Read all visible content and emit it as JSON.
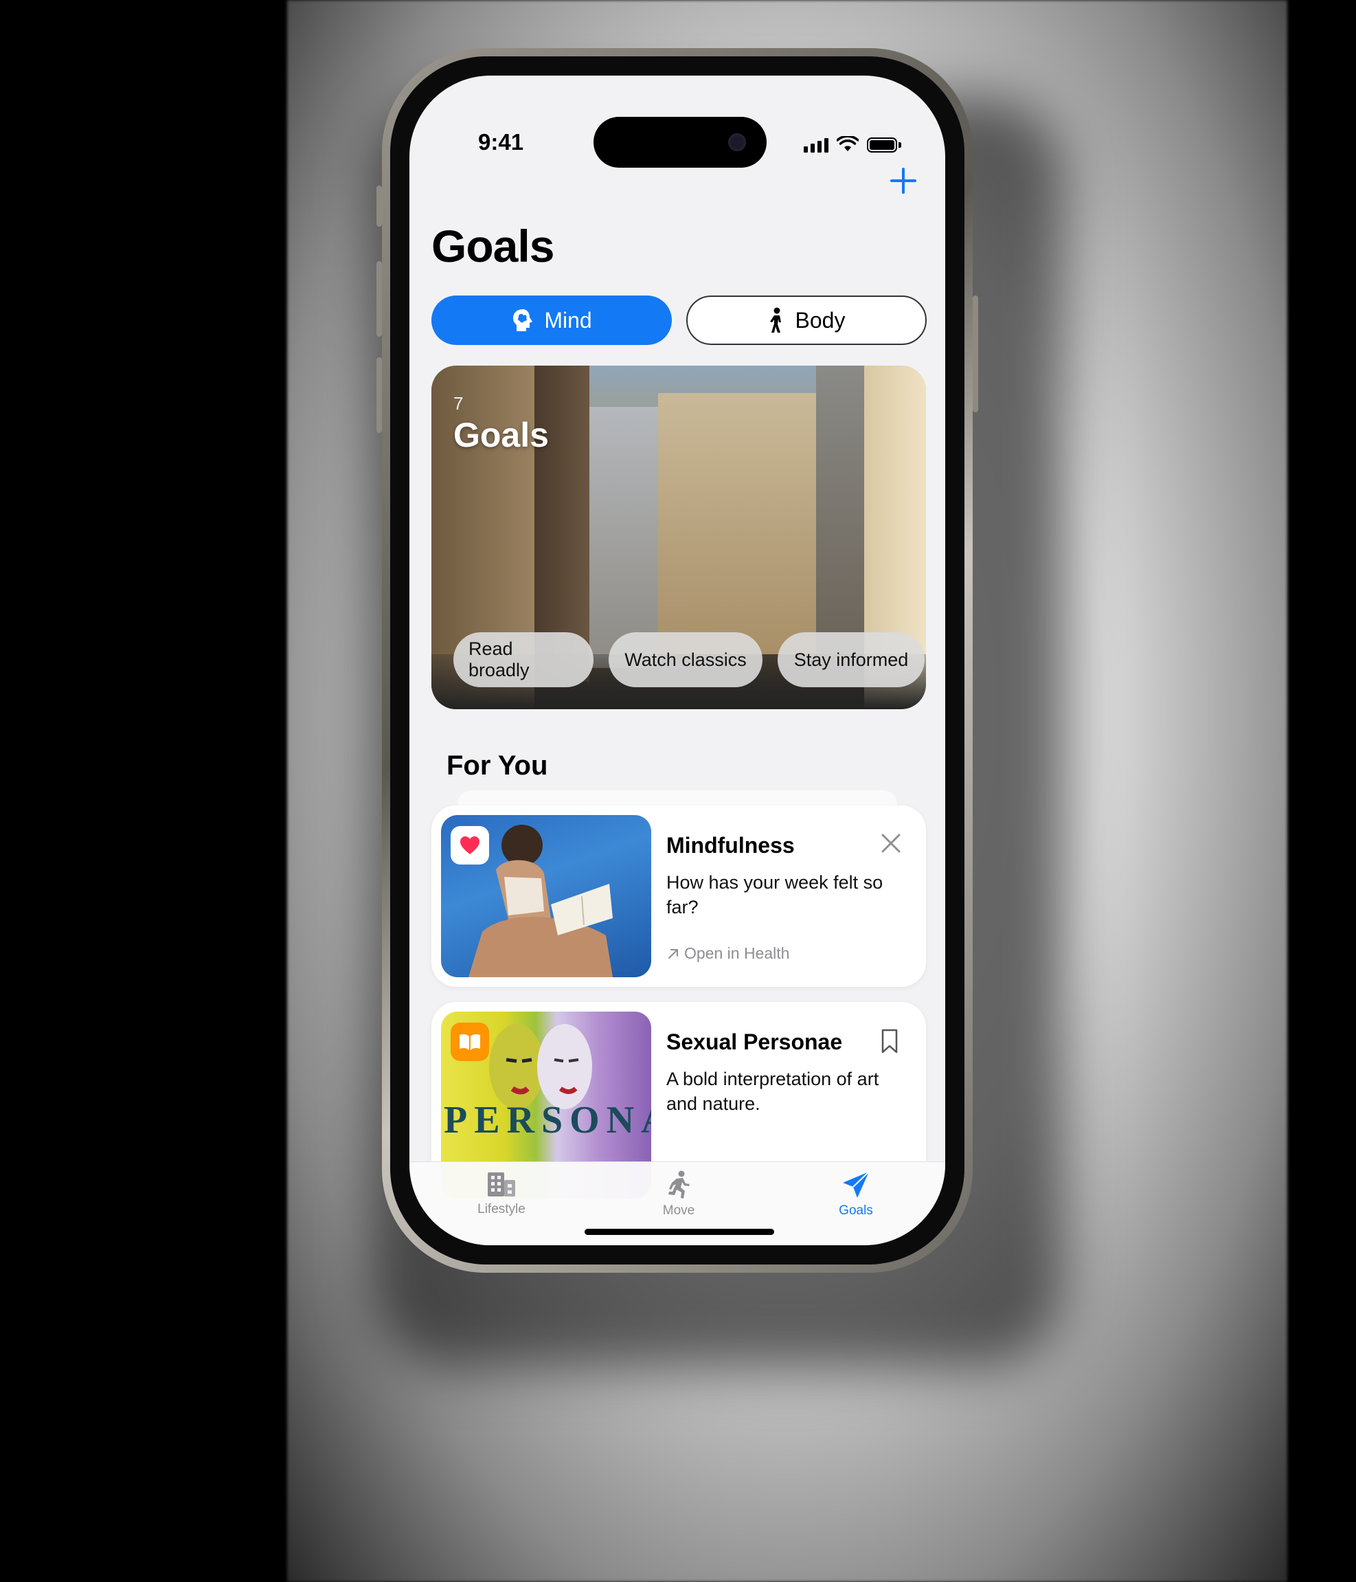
{
  "status_bar": {
    "time": "9:41"
  },
  "header": {
    "title": "Goals",
    "add_icon": "plus-icon"
  },
  "segments": [
    {
      "label": "Mind",
      "icon": "brain-head-icon",
      "selected": true
    },
    {
      "label": "Body",
      "icon": "walking-figure-icon",
      "selected": false
    }
  ],
  "hero": {
    "count": "7",
    "title": "Goals",
    "chips": [
      "Read broadly",
      "Watch classics",
      "Stay informed"
    ]
  },
  "for_you": {
    "title": "For You",
    "cards": [
      {
        "title": "Mindfulness",
        "body": "How has your week felt so far?",
        "link": "Open in Health",
        "app_icon": "health-heart-icon",
        "action_icon": "close-icon"
      },
      {
        "title": "Sexual Personae",
        "body": "A bold interpretation of art and nature.",
        "app_icon": "books-icon",
        "action_icon": "bookmark-icon"
      }
    ]
  },
  "tabbar": {
    "items": [
      {
        "label": "Lifestyle",
        "icon": "building-icon",
        "active": false
      },
      {
        "label": "Move",
        "icon": "running-figure-icon",
        "active": false
      },
      {
        "label": "Goals",
        "icon": "paper-plane-icon",
        "active": true
      }
    ]
  },
  "colors": {
    "accent": "#1479f5",
    "background": "#f2f2f4"
  }
}
